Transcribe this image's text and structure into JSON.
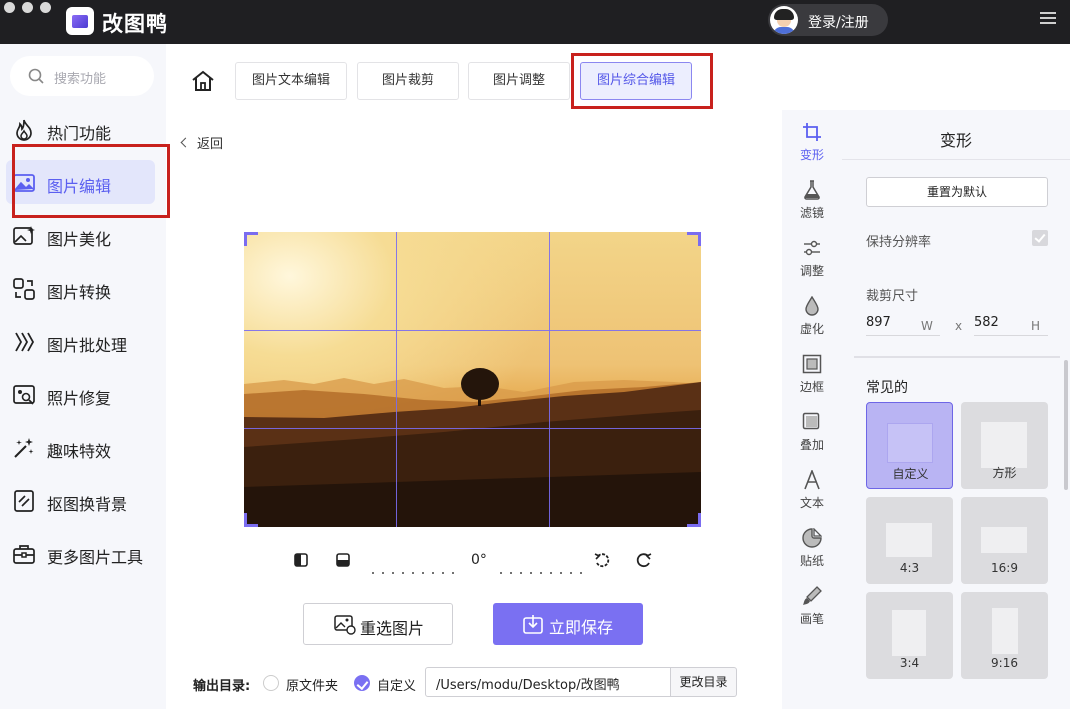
{
  "app": {
    "title": "改图鸭",
    "login_label": "登录/注册"
  },
  "sidebar": {
    "search_placeholder": "搜索功能",
    "items": [
      {
        "label": "热门功能",
        "icon": "flame-icon"
      },
      {
        "label": "图片编辑",
        "icon": "image-edit-icon",
        "active": true
      },
      {
        "label": "图片美化",
        "icon": "image-beautify-icon"
      },
      {
        "label": "图片转换",
        "icon": "convert-icon"
      },
      {
        "label": "图片批处理",
        "icon": "batch-icon"
      },
      {
        "label": "照片修复",
        "icon": "photo-repair-icon"
      },
      {
        "label": "趣味特效",
        "icon": "magic-wand-icon"
      },
      {
        "label": "抠图换背景",
        "icon": "cutout-icon"
      },
      {
        "label": "更多图片工具",
        "icon": "toolbox-icon"
      }
    ]
  },
  "tabs": [
    {
      "label": "图片文本编辑"
    },
    {
      "label": "图片裁剪"
    },
    {
      "label": "图片调整"
    },
    {
      "label": "图片综合编辑",
      "active": true
    }
  ],
  "editor": {
    "back_label": "返回",
    "rotation_angle": "0°",
    "reselect_label": "重选图片",
    "save_label": "立即保存"
  },
  "output": {
    "label": "输出目录:",
    "option_original": "原文件夹",
    "option_custom": "自定义",
    "selected": "custom",
    "path": "/Users/modu/Desktop/改图鸭",
    "change_label": "更改目录"
  },
  "tools": [
    {
      "label": "变形",
      "icon": "crop-icon",
      "active": true
    },
    {
      "label": "滤镜",
      "icon": "flask-icon"
    },
    {
      "label": "调整",
      "icon": "sliders-icon"
    },
    {
      "label": "虚化",
      "icon": "drop-icon"
    },
    {
      "label": "边框",
      "icon": "frame-icon"
    },
    {
      "label": "叠加",
      "icon": "overlay-icon"
    },
    {
      "label": "文本",
      "icon": "text-icon"
    },
    {
      "label": "贴纸",
      "icon": "sticker-icon"
    },
    {
      "label": "画笔",
      "icon": "brush-icon"
    }
  ],
  "panel": {
    "title": "变形",
    "reset_label": "重置为默认",
    "keep_resolution_label": "保持分辨率",
    "keep_resolution": true,
    "crop_size_label": "裁剪尺寸",
    "width_value": "897",
    "width_unit": "W",
    "times": "x",
    "height_value": "582",
    "height_unit": "H",
    "common_title": "常见的",
    "presets": [
      {
        "label": "自定义",
        "active": true
      },
      {
        "label": "方形"
      },
      {
        "label": "4:3"
      },
      {
        "label": "16:9"
      },
      {
        "label": "3:4"
      },
      {
        "label": "9:16"
      }
    ]
  },
  "colors": {
    "accent": "#7a70f2",
    "highlight_frame": "#c8211d",
    "titlebar": "#1f1f22"
  }
}
